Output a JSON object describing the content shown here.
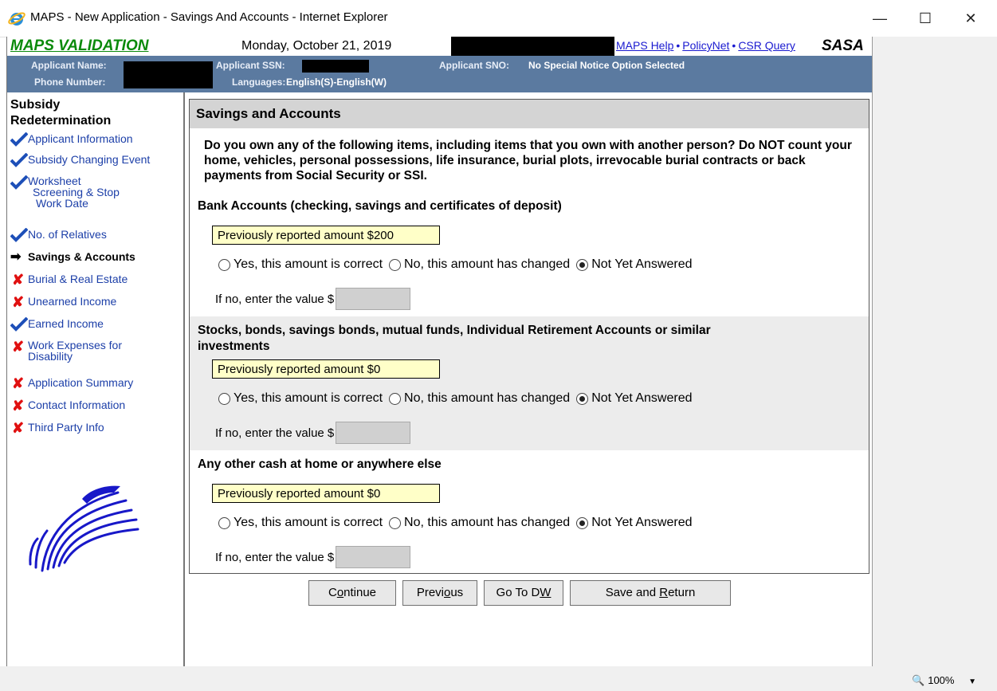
{
  "window": {
    "title": "MAPS - New Application - Savings And Accounts - Internet Explorer",
    "controls": {
      "minimize": "—",
      "maximize": "☐",
      "close": "✕"
    }
  },
  "header": {
    "brand": "MAPS VALIDATION",
    "date": "Monday, October 21, 2019",
    "links": {
      "help": "MAPS Help",
      "policynet": "PolicyNet",
      "csr": "CSR Query",
      "sep": "•"
    },
    "agency": "SASA"
  },
  "applicant": {
    "name_label": "Applicant Name:",
    "phone_label": "Phone Number:",
    "ssn_label": "Applicant SSN:",
    "languages_label": "Languages:",
    "languages_value": "English(S)-English(W)",
    "sno_label": "Applicant SNO:",
    "sno_value": "No Special Notice Option Selected"
  },
  "nav": {
    "title_line1": "Subsidy",
    "title_line2": "Redetermination",
    "items": [
      {
        "label": "Applicant Information",
        "status": "check"
      },
      {
        "label": "Subsidy Changing Event",
        "status": "check"
      },
      {
        "label": "Worksheet Screening & Stop Work Date",
        "status": "check",
        "lines": [
          "Worksheet",
          "Screening  & Stop",
          "Work  Date"
        ]
      },
      {
        "label": "No. of Relatives",
        "status": "check"
      },
      {
        "label": "Savings & Accounts",
        "status": "current"
      },
      {
        "label": "Burial & Real Estate",
        "status": "x"
      },
      {
        "label": "Unearned Income",
        "status": "x"
      },
      {
        "label": "Earned Income",
        "status": "check"
      },
      {
        "label": "Work Expenses for Disability",
        "status": "x",
        "lines": [
          "Work Expenses for",
          "Disability"
        ]
      },
      {
        "label": "Application Summary",
        "status": "x"
      },
      {
        "label": "Contact Information",
        "status": "x"
      },
      {
        "label": "Third Party Info",
        "status": "x"
      }
    ]
  },
  "main": {
    "heading": "Savings and Accounts",
    "intro": "Do you  own any of the following items, including items that you own with another person? Do NOT count your home, vehicles, personal possessions, life insurance, burial plots, irrevocable burial contracts or back payments from Social Security or SSI.",
    "radio_labels": {
      "yes": "Yes, this amount is correct",
      "no": "No, this amount has changed",
      "not_yet": "Not Yet Answered"
    },
    "ifno_label": "If no, enter the value $",
    "sections": [
      {
        "title": "Bank Accounts (checking, savings and certificates of deposit)",
        "previous": "Previously reported amount $200",
        "selected": "not_yet"
      },
      {
        "title_line1": "Stocks, bonds, savings bonds, mutual funds, Individual Retirement Accounts or similar",
        "title_line2": "investments",
        "previous": "Previously reported amount $0",
        "selected": "not_yet"
      },
      {
        "title": "Any other cash at home or anywhere else",
        "previous": "Previously reported amount $0",
        "selected": "not_yet"
      }
    ]
  },
  "buttons": {
    "continue": {
      "pre": "C",
      "u": "o",
      "post": "ntinue"
    },
    "previous": {
      "pre": "Previ",
      "u": "o",
      "post": "us"
    },
    "goto_dw": {
      "pre": "Go To D",
      "u": "W",
      "post": ""
    },
    "save_return": {
      "pre": "Save and ",
      "u": "R",
      "post": "eturn"
    }
  },
  "status": {
    "zoom": "100%"
  },
  "colors": {
    "brand_green": "#0a8a0a",
    "appbar_blue": "#5b7aa0",
    "link_blue": "#1c3fa8",
    "prev_amount_bg": "#ffffc8",
    "error_red": "#e01010"
  }
}
